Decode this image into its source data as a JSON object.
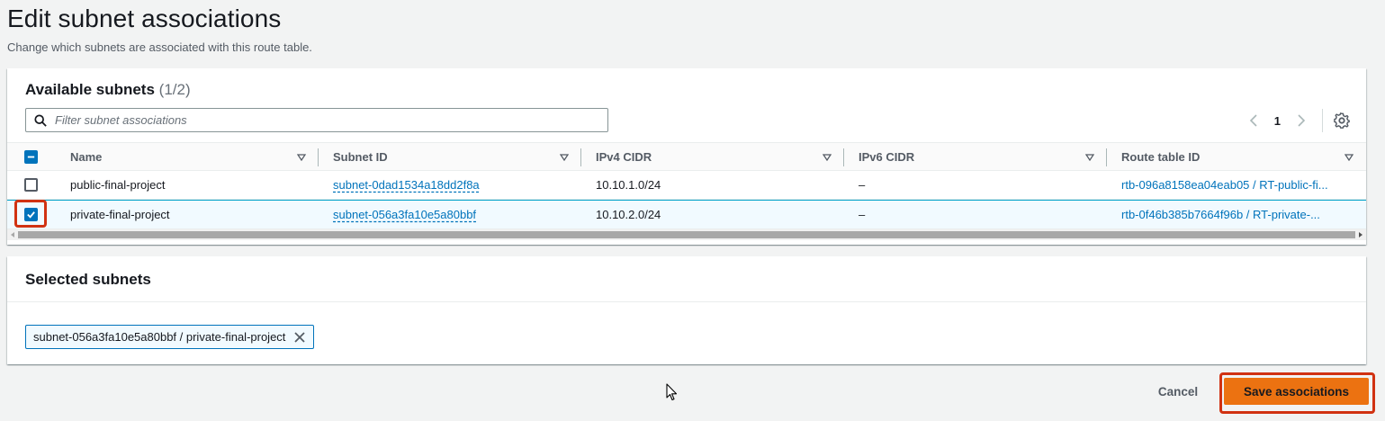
{
  "header": {
    "title": "Edit subnet associations",
    "description": "Change which subnets are associated with this route table."
  },
  "available": {
    "title": "Available subnets",
    "count": "(1/2)",
    "filter_placeholder": "Filter subnet associations",
    "page": "1",
    "columns": [
      "Name",
      "Subnet ID",
      "IPv4 CIDR",
      "IPv6 CIDR",
      "Route table ID"
    ],
    "rows": [
      {
        "checked": false,
        "name": "public-final-project",
        "subnet_id": "subnet-0dad1534a18dd2f8a",
        "ipv4": "10.10.1.0/24",
        "ipv6": "–",
        "route_table": "rtb-096a8158ea04eab05 / RT-public-fi..."
      },
      {
        "checked": true,
        "name": "private-final-project",
        "subnet_id": "subnet-056a3fa10e5a80bbf",
        "ipv4": "10.10.2.0/24",
        "ipv6": "–",
        "route_table": "rtb-0f46b385b7664f96b / RT-private-..."
      }
    ]
  },
  "selected": {
    "title": "Selected subnets",
    "token": "subnet-056a3fa10e5a80bbf / private-final-project"
  },
  "actions": {
    "cancel": "Cancel",
    "save": "Save associations"
  },
  "colors": {
    "accent": "#0073bb",
    "primary_button": "#ec7211",
    "highlight": "#d13212"
  }
}
